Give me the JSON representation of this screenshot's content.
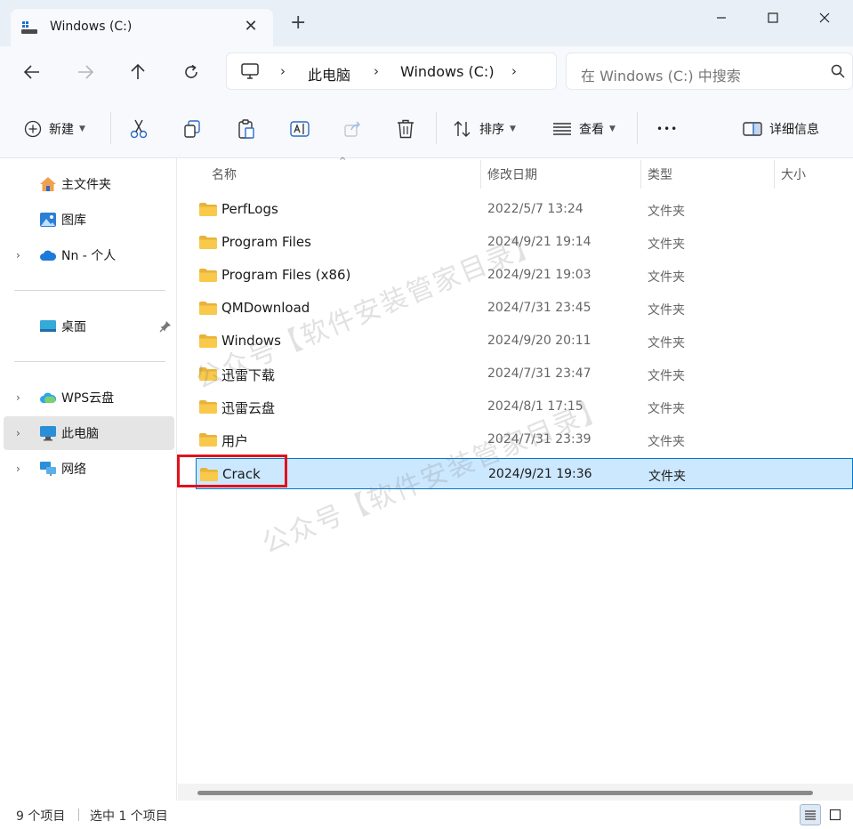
{
  "window": {
    "tab_title": "Windows (C:)",
    "close_tab": "✕",
    "add_tab": "+"
  },
  "address": {
    "crumbs": [
      "此电脑",
      "Windows (C:)"
    ],
    "sep": "›"
  },
  "search": {
    "placeholder": "在 Windows (C:) 中搜索"
  },
  "toolbar": {
    "new_label": "新建",
    "sort_label": "排序",
    "view_label": "查看",
    "details_label": "详细信息",
    "more_label": "•••"
  },
  "sidebar": {
    "items": [
      {
        "label": "主文件夹"
      },
      {
        "label": "图库"
      },
      {
        "label": "Nn - 个人"
      },
      {
        "label": "桌面"
      },
      {
        "label": "WPS云盘"
      },
      {
        "label": "此电脑"
      },
      {
        "label": "网络"
      }
    ]
  },
  "columns": {
    "name": "名称",
    "date": "修改日期",
    "type": "类型",
    "size": "大小"
  },
  "files": [
    {
      "name": "PerfLogs",
      "date": "2022/5/7 13:24",
      "type": "文件夹"
    },
    {
      "name": "Program Files",
      "date": "2024/9/21 19:14",
      "type": "文件夹"
    },
    {
      "name": "Program Files (x86)",
      "date": "2024/9/21 19:03",
      "type": "文件夹"
    },
    {
      "name": "QMDownload",
      "date": "2024/7/31 23:45",
      "type": "文件夹"
    },
    {
      "name": "Windows",
      "date": "2024/9/20 20:11",
      "type": "文件夹"
    },
    {
      "name": "迅雷下载",
      "date": "2024/7/31 23:47",
      "type": "文件夹"
    },
    {
      "name": "迅雷云盘",
      "date": "2024/8/1 17:15",
      "type": "文件夹"
    },
    {
      "name": "用户",
      "date": "2024/7/31 23:39",
      "type": "文件夹"
    },
    {
      "name": "Crack",
      "date": "2024/9/21 19:36",
      "type": "文件夹"
    }
  ],
  "status": {
    "count": "9 个项目",
    "selected": "选中 1 个项目"
  },
  "watermark": {
    "text": "公众号【软件安装管家目录】"
  },
  "colors": {
    "accent": "#0078d4",
    "selection": "#cce8ff",
    "folder": "#f8c94a",
    "highlight": "#e0121b"
  }
}
